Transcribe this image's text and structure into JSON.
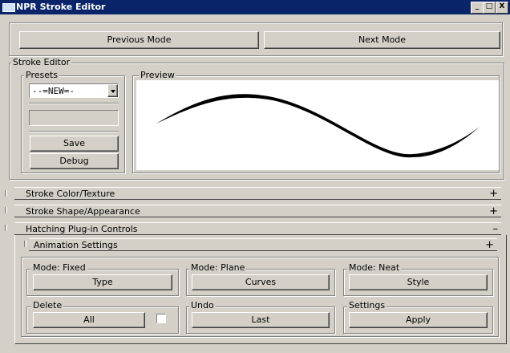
{
  "window": {
    "title": "NPR Stroke Editor",
    "controls": [
      "_",
      "□",
      "X"
    ]
  },
  "mode_nav": {
    "previous": "Previous Mode",
    "next": "Next Mode"
  },
  "stroke_editor": {
    "label": "Stroke Editor",
    "presets": {
      "label": "Presets",
      "selected": "--=NEW=-",
      "save": "Save",
      "debug": "Debug"
    },
    "preview": {
      "label": "Preview"
    }
  },
  "rollouts": [
    {
      "label": "Stroke Color/Texture",
      "sign": "+"
    },
    {
      "label": "Stroke Shape/Appearance",
      "sign": "+"
    },
    {
      "label": "Hatching Plug-in Controls",
      "sign": "–"
    }
  ],
  "animation": {
    "label": "Animation Settings",
    "sign": "+"
  },
  "hatching": {
    "mode_fixed": {
      "label": "Mode: Fixed",
      "button": "Type"
    },
    "mode_plane": {
      "label": "Mode: Plane",
      "button": "Curves"
    },
    "mode_neat": {
      "label": "Mode: Neat",
      "button": "Style"
    },
    "delete": {
      "label": "Delete",
      "button": "All"
    },
    "undo": {
      "label": "Undo",
      "button": "Last"
    },
    "settings": {
      "label": "Settings",
      "button": "Apply"
    }
  }
}
